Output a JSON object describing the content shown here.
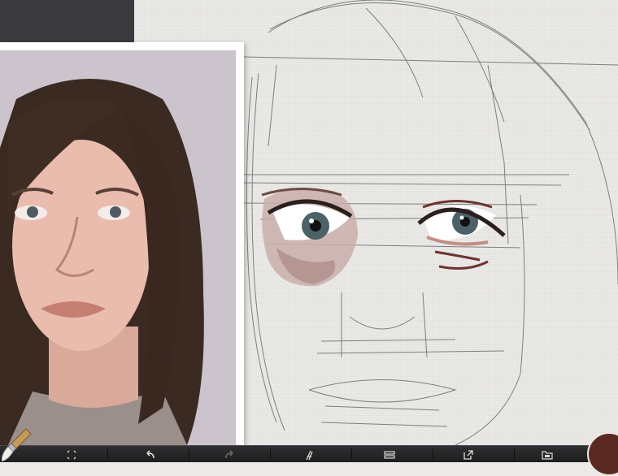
{
  "app": {
    "accent_color": "#5a2a22",
    "toolbar_color": "#252527"
  },
  "toolbar": {
    "items": [
      {
        "name": "transform-tool",
        "icon": "move-arrows-icon"
      },
      {
        "name": "undo-button",
        "icon": "undo-arrow-icon"
      },
      {
        "name": "redo-button",
        "icon": "redo-arrow-icon"
      },
      {
        "name": "brush-library-button",
        "icon": "brush-pen-icon"
      },
      {
        "name": "layers-button",
        "icon": "layers-icon"
      },
      {
        "name": "share-button",
        "icon": "share-export-icon"
      },
      {
        "name": "gallery-button",
        "icon": "folder-icon"
      }
    ]
  },
  "brush": {
    "icon": "brush-icon",
    "tip_color": "#f2efea"
  },
  "color_picker": {
    "current_color": "#5a2a22"
  },
  "reference": {
    "icon": "reference-photo-image"
  }
}
